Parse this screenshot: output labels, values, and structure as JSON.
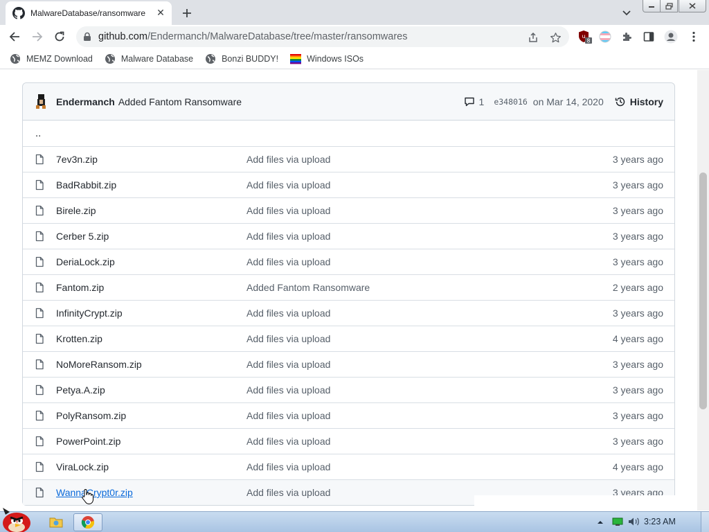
{
  "browser": {
    "tab": {
      "title": "MalwareDatabase/ransomware",
      "close": "✕"
    },
    "new_tab": "+",
    "url": {
      "host": "github.com",
      "path": "/Endermanch/MalwareDatabase/tree/master/ransomwares"
    },
    "extension_badge": "8",
    "bookmarks": [
      {
        "label": "MEMZ Download",
        "icon": "globe-icon"
      },
      {
        "label": "Malware Database",
        "icon": "globe-icon"
      },
      {
        "label": "Bonzi BUDDY!",
        "icon": "bonzi-icon"
      },
      {
        "label": "Windows ISOs",
        "icon": "rainbow-flag-icon"
      }
    ]
  },
  "commit": {
    "author": "Endermanch",
    "message": "Added Fantom Ransomware",
    "comments": "1",
    "sha": "e348016",
    "date": "on Mar 14, 2020",
    "history": "History"
  },
  "parent_dir": "..",
  "files": [
    {
      "name": "7ev3n.zip",
      "message": "Add files via upload",
      "age": "3 years ago"
    },
    {
      "name": "BadRabbit.zip",
      "message": "Add files via upload",
      "age": "3 years ago"
    },
    {
      "name": "Birele.zip",
      "message": "Add files via upload",
      "age": "3 years ago"
    },
    {
      "name": "Cerber 5.zip",
      "message": "Add files via upload",
      "age": "3 years ago"
    },
    {
      "name": "DeriaLock.zip",
      "message": "Add files via upload",
      "age": "3 years ago"
    },
    {
      "name": "Fantom.zip",
      "message": "Added Fantom Ransomware",
      "age": "2 years ago"
    },
    {
      "name": "InfinityCrypt.zip",
      "message": "Add files via upload",
      "age": "3 years ago"
    },
    {
      "name": "Krotten.zip",
      "message": "Add files via upload",
      "age": "4 years ago"
    },
    {
      "name": "NoMoreRansom.zip",
      "message": "Add files via upload",
      "age": "3 years ago"
    },
    {
      "name": "Petya.A.zip",
      "message": "Add files via upload",
      "age": "3 years ago"
    },
    {
      "name": "PolyRansom.zip",
      "message": "Add files via upload",
      "age": "3 years ago"
    },
    {
      "name": "PowerPoint.zip",
      "message": "Add files via upload",
      "age": "3 years ago"
    },
    {
      "name": "ViraLock.zip",
      "message": "Add files via upload",
      "age": "4 years ago"
    },
    {
      "name": "WannaCrypt0r.zip",
      "message": "Add files via upload",
      "age": "3 years ago"
    }
  ],
  "taskbar": {
    "clock": "3:23 AM"
  },
  "colors": {
    "link": "#0969da",
    "muted": "#57606a",
    "border": "#d0d7de"
  }
}
